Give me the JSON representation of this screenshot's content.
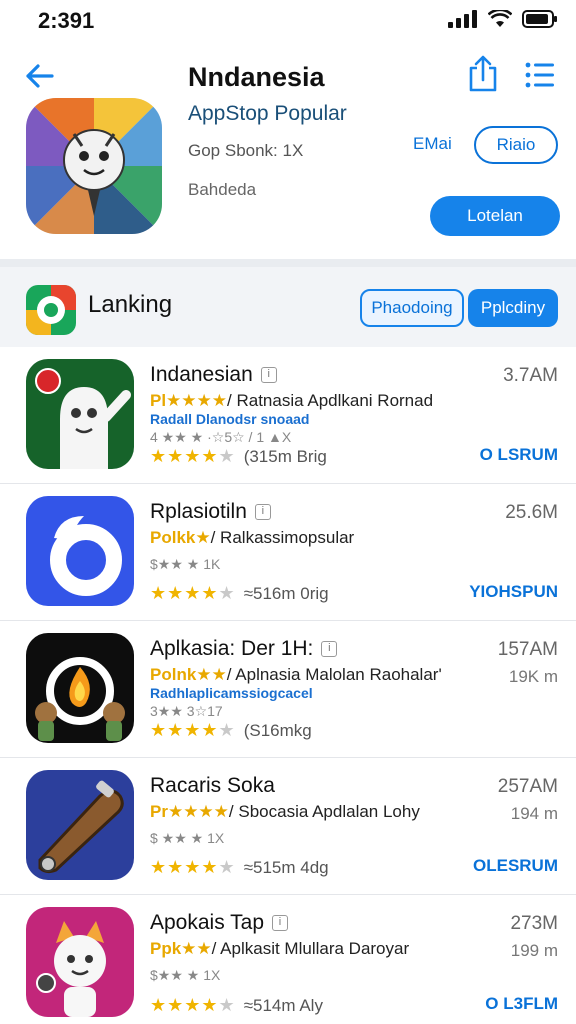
{
  "status_bar": {
    "time": "2:391"
  },
  "header": {
    "title": "Nndanesia",
    "subtitle": "AppStop Popular",
    "meta": "Gop Sbonk: 1X",
    "developer": "Bahdeda",
    "link_label": "EMai",
    "outline_button": "Riaio",
    "primary_button": "Lotelan"
  },
  "section": {
    "title": "Lanking",
    "segment_1": "Phaodoing",
    "segment_2": "Pplcdiny"
  },
  "apps": [
    {
      "name": "Indanesian",
      "stars_prefix": "Pl★★★★",
      "description": "/ Ratnasia Apdlkani Rornad",
      "sub_blue": "Radall Dlanodsr snoaad",
      "sub_gray": "4 ★★ ★ ·☆5☆ / 1 ▲X",
      "rating_text": "(315m Brig",
      "size": "3.7AM",
      "size2": "",
      "action": "O LSRUM",
      "icon": "ghost-mascot-icon",
      "icon_bg": "#16632a"
    },
    {
      "name": "Rplasiotiln",
      "stars_prefix": "Polkk★",
      "description": "/ Ralkassimopsular",
      "sub_blue": "",
      "sub_gray": "$★★ ★ 1K",
      "rating_text": "≈516m 0rig",
      "size": "25.6M",
      "size2": "",
      "action": "YIOHSPUN",
      "icon": "wave-circle-icon",
      "icon_bg": "#3355e8"
    },
    {
      "name": "Aplkasia: Der 1H:",
      "stars_prefix": "Polnk★★",
      "description": "/ Aplnasia Malolan Raohalar'",
      "sub_blue": "Radhlaplicamssiogcacel",
      "sub_gray": "3★★ 3☆17",
      "rating_text": "(S16mkg",
      "size": "157AM",
      "size2": "19K m",
      "action": "",
      "icon": "fire-ring-icon",
      "icon_bg": "#0d0d0d"
    },
    {
      "name": "Racaris Soka",
      "stars_prefix": "Pr★★★★",
      "description": "/ Sbocasia Apdlalan Lohy",
      "sub_blue": "",
      "sub_gray": "$ ★★ ★ 1X",
      "rating_text": "≈515m 4dg",
      "size": "257AM",
      "size2": "194 m",
      "action": "OLESRUM",
      "icon": "bat-tool-icon",
      "icon_bg": "#2c3f9c"
    },
    {
      "name": "Apokais Tap",
      "stars_prefix": "Ppk★★",
      "description": "/ Aplkasit Mlullara Daroyar",
      "sub_blue": "",
      "sub_gray": "$★★ ★ 1X",
      "rating_text": "≈514m Aly",
      "size": "273M",
      "size2": "199 m",
      "action": "O L3FLM",
      "icon": "fox-mascot-icon",
      "icon_bg": "#c2267a"
    }
  ],
  "colors": {
    "accent": "#1683ea",
    "link": "#0a72d8",
    "star": "#f0b400",
    "divider": "#e9ecf0"
  }
}
